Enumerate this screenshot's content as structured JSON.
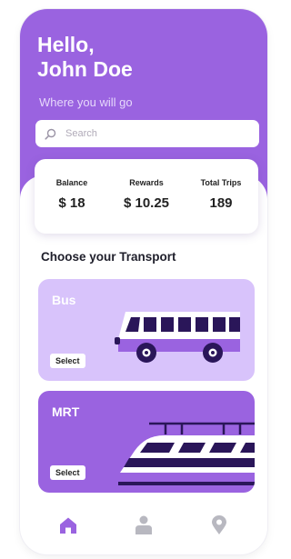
{
  "header": {
    "greeting_line1": "Hello,",
    "greeting_line2": "John Doe",
    "subtitle": "Where you will go"
  },
  "search": {
    "placeholder": "Search",
    "icon": "search-icon"
  },
  "stats": [
    {
      "label": "Balance",
      "value": "$ 18"
    },
    {
      "label": "Rewards",
      "value": "$ 10.25"
    },
    {
      "label": "Total Trips",
      "value": "189"
    }
  ],
  "section_title": "Choose your Transport",
  "transports": [
    {
      "name": "Bus",
      "select_label": "Select",
      "icon": "bus-icon"
    },
    {
      "name": "MRT",
      "select_label": "Select",
      "icon": "train-icon"
    }
  ],
  "nav": [
    {
      "icon": "home-icon",
      "active": true
    },
    {
      "icon": "user-icon",
      "active": false
    },
    {
      "icon": "location-pin-icon",
      "active": false
    }
  ],
  "colors": {
    "primary": "#9a63e0",
    "primary_light": "#d8c3fb",
    "dark": "#2a1659",
    "nav_inactive": "#b8b8c0"
  }
}
